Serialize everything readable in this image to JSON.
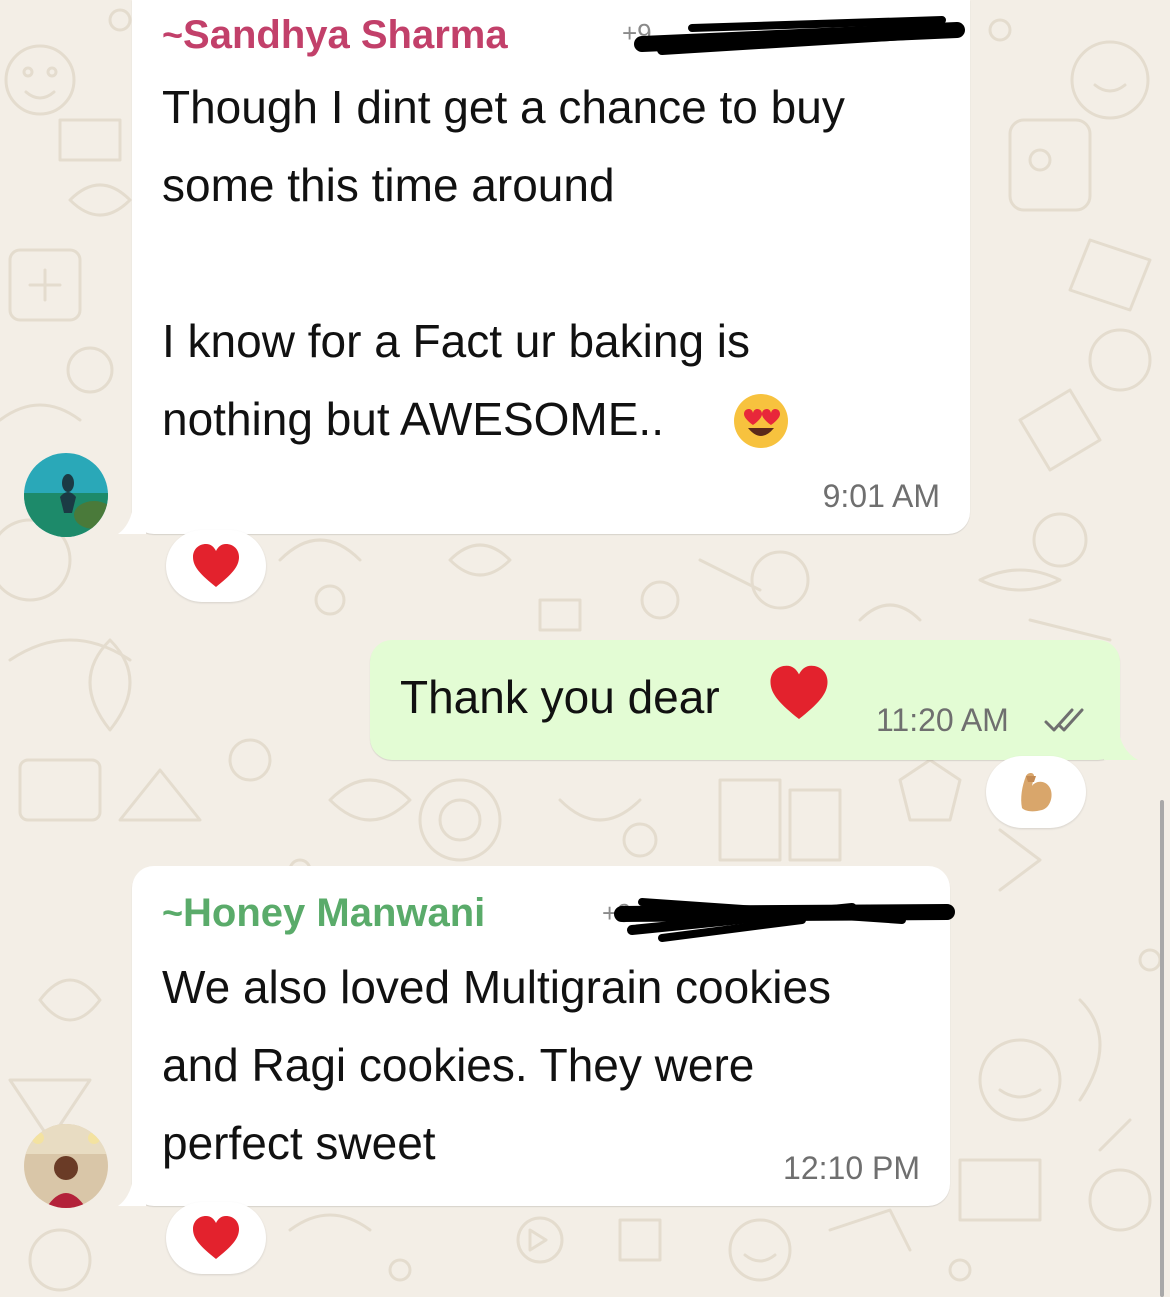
{
  "messages": [
    {
      "sender_tilde": "~",
      "sender": "Sandhya Sharma",
      "sender_color": "#c2406a",
      "phone_partial": "+9",
      "text": "Though I dint get a chance to buy\nsome this time around\n\nI know for a Fact ur baking is\nnothing but AWESOME..",
      "emoji": "heart-eyes-emoji",
      "time": "9:01 AM",
      "reaction": "red-heart"
    },
    {
      "text": "Thank you dear",
      "emoji": "red-heart",
      "time": "11:20 AM",
      "status": "read-double-check",
      "reaction": "flexed-biceps"
    },
    {
      "sender_tilde": "~",
      "sender": "Honey Manwani",
      "sender_color": "#5aab6a",
      "phone_partial": "+9",
      "text": "We also loved Multigrain cookies\nand Ragi cookies. They were\nperfect sweet",
      "time": "12:10 PM",
      "reaction": "red-heart"
    }
  ],
  "colors": {
    "background": "#f3eee6",
    "incoming_bubble": "#ffffff",
    "outgoing_bubble": "#e3fcd4",
    "read_ticks": "#6f6f6f"
  }
}
